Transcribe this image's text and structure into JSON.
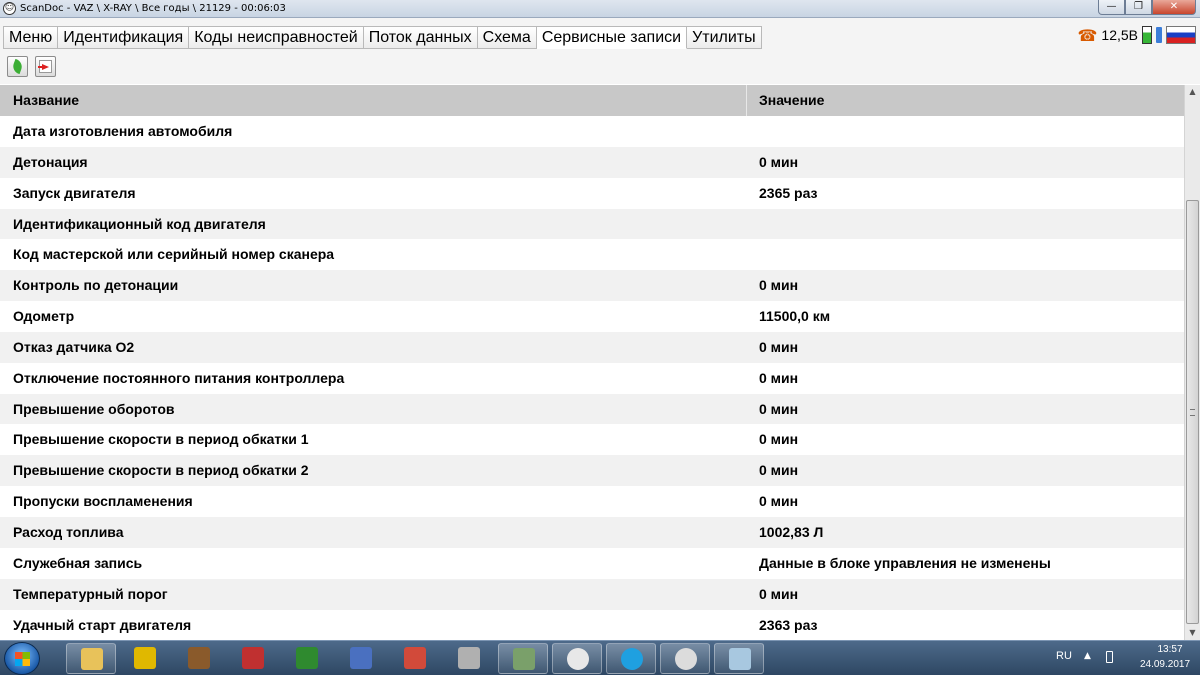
{
  "window": {
    "title": "ScanDoc - VAZ \\ X-RAY \\ Все годы \\ 21129 - 00:06:03",
    "minimize": "—",
    "restore": "❐",
    "close": "✕"
  },
  "tabs": [
    {
      "label": "Меню",
      "active": false
    },
    {
      "label": "Идентификация",
      "active": false
    },
    {
      "label": "Коды неисправностей",
      "active": false
    },
    {
      "label": "Поток данных",
      "active": false
    },
    {
      "label": "Схема",
      "active": false
    },
    {
      "label": "Сервисные записи",
      "active": true
    },
    {
      "label": "Утилиты",
      "active": false
    }
  ],
  "status": {
    "icon": "phone-icon",
    "voltage": "12,5В",
    "language_flag": "flag-ru-icon"
  },
  "toolbar": {
    "buttons": [
      "leaf-icon",
      "exit-icon"
    ]
  },
  "table": {
    "columns": [
      "Название",
      "Значение"
    ],
    "rows": [
      [
        "Дата изготовления автомобиля",
        ""
      ],
      [
        "Детонация",
        "0 мин"
      ],
      [
        "Запуск двигателя",
        "2365 раз"
      ],
      [
        "Идентификационный код двигателя",
        ""
      ],
      [
        "Код мастерской или серийный номер сканера",
        ""
      ],
      [
        "Контроль по детонации",
        "0 мин"
      ],
      [
        "Одометр",
        "11500,0 км"
      ],
      [
        "Отказ датчика O2",
        "0 мин"
      ],
      [
        "Отключение постоянного питания контроллера",
        "0 мин"
      ],
      [
        "Превышение оборотов",
        "0 мин"
      ],
      [
        "Превышение скорости в период обкатки 1",
        "0 мин"
      ],
      [
        "Превышение скорости в период обкатки 2",
        "0 мин"
      ],
      [
        "Пропуски воспламенения",
        "0 мин"
      ],
      [
        "Расход топлива",
        "1002,83 Л"
      ],
      [
        "Служебная запись",
        "Данные в блоке управления не изменены"
      ],
      [
        "Температурный порог",
        "0 мин"
      ],
      [
        "Удачный старт двигателя",
        "2363 раз"
      ]
    ]
  },
  "taskbar": {
    "items": [
      "explorer-icon",
      "chip-icon",
      "ecu-icon",
      "car-tool-icon",
      "seven-icon",
      "scanner-icon",
      "app-icon",
      "calc-icon",
      "scandoc-icon",
      "yandex-icon",
      "skype-icon",
      "sd-icon",
      "book-icon"
    ],
    "lang": "RU",
    "time": "13:57",
    "date": "24.09.2017"
  }
}
